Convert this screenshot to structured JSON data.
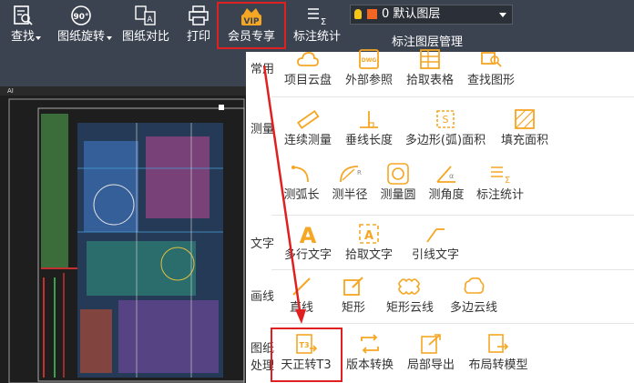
{
  "toolbar": {
    "find": "查找",
    "rotate": "图纸旋转",
    "compare": "图纸对比",
    "print": "打印",
    "vip_badge": "VIP",
    "vip": "会员专享",
    "dim_stats": "标注统计",
    "layer_current": "0 默认图层",
    "layer_manage": "标注图层管理"
  },
  "canvas": {
    "tab_label": "AI"
  },
  "panel": {
    "sections": {
      "common": "常用",
      "measure": "测量",
      "text": "文字",
      "draw": "画线",
      "process_line1": "图纸",
      "process_line2": "处理"
    },
    "common": [
      "项目云盘",
      "外部参照",
      "拾取表格",
      "查找图形"
    ],
    "measure_row1": [
      "连续测量",
      "垂线长度",
      "多边形(弧)面积",
      "填充面积"
    ],
    "measure_row2": [
      "测弧长",
      "测半径",
      "测量圆",
      "测角度",
      "标注统计"
    ],
    "text": [
      "多行文字",
      "拾取文字",
      "引线文字"
    ],
    "draw": [
      "直线",
      "矩形",
      "矩形云线",
      "多边云线"
    ],
    "process": [
      "天正转T3",
      "版本转换",
      "局部导出",
      "布局转模型"
    ]
  },
  "colors": {
    "toolbar_bg": "#3b4250",
    "accent_orange": "#f5a623",
    "highlight_red": "#e02020",
    "panel_bg": "#ffffff"
  }
}
